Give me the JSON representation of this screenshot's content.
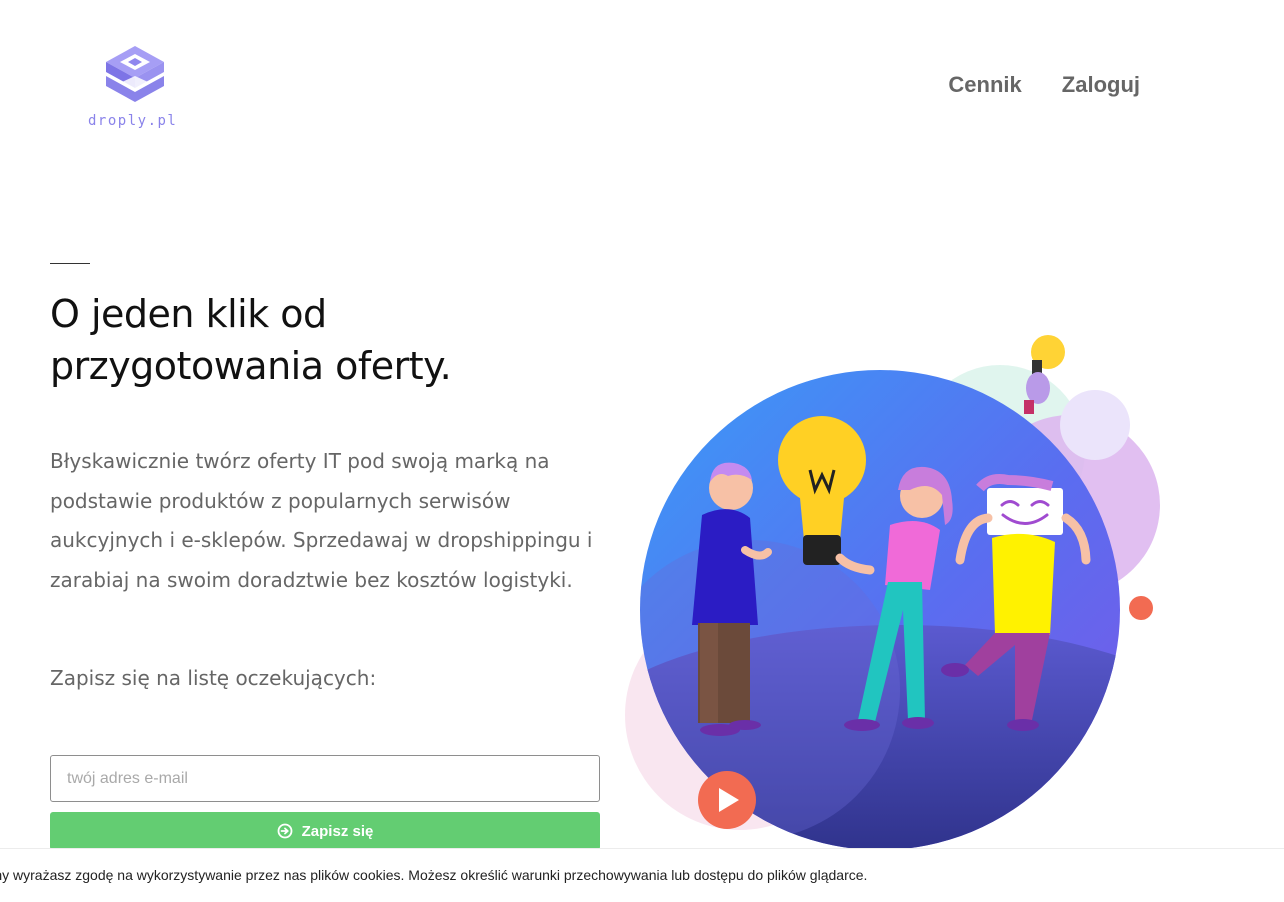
{
  "brand": {
    "name": "droply.pl",
    "accent": "#8a83ea"
  },
  "nav": {
    "items": [
      {
        "label": "Cennik"
      },
      {
        "label": "Zaloguj"
      }
    ]
  },
  "hero": {
    "headline_line1": "O jeden klik od",
    "headline_line2": "przygotowania oferty.",
    "description": "Błyskawicznie twórz oferty IT pod swoją marką na podstawie produktów z popularnych serwisów aukcyjnych i e-sklepów. Sprzedawaj w dropshippingu i zarabiaj na swoim doradztwie bez kosztów logistyki.",
    "subscribe_label": "Zapisz się na listę oczekujących:"
  },
  "form": {
    "email_placeholder": "twój adres e-mail",
    "email_value": "",
    "submit_label": "Zapisz się",
    "submit_color": "#63cd72"
  },
  "cookie": {
    "text": "trony wyrażasz zgodę na wykorzystywanie przez nas plików cookies. Możesz określić warunki przechowywania lub dostępu do plików glądarce."
  },
  "icons": {
    "logo": "droply-logo-icon",
    "submit": "arrow-circle-right-icon",
    "video": "play-icon"
  }
}
